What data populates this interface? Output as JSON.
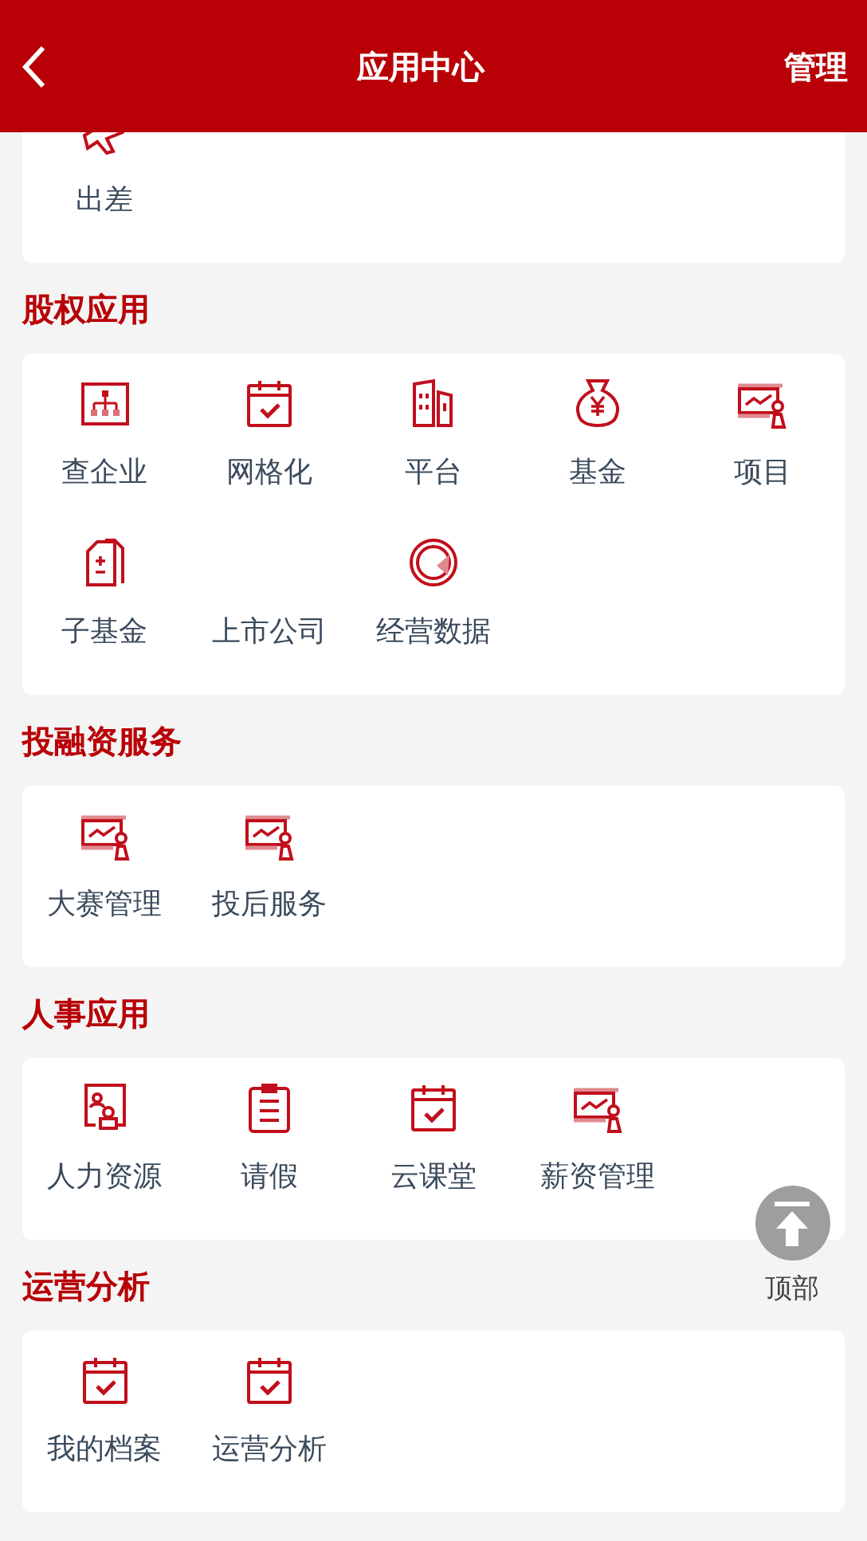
{
  "header": {
    "title": "应用中心",
    "action": "管理"
  },
  "sections": [
    {
      "items": [
        {
          "label": "出差"
        }
      ]
    },
    {
      "title": "股权应用",
      "items": [
        {
          "label": "查企业"
        },
        {
          "label": "网格化"
        },
        {
          "label": "平台"
        },
        {
          "label": "基金"
        },
        {
          "label": "项目"
        },
        {
          "label": "子基金"
        },
        {
          "label": "上市公司"
        },
        {
          "label": "经营数据"
        }
      ]
    },
    {
      "title": "投融资服务",
      "items": [
        {
          "label": "大赛管理"
        },
        {
          "label": "投后服务"
        }
      ]
    },
    {
      "title": "人事应用",
      "items": [
        {
          "label": "人力资源"
        },
        {
          "label": "请假"
        },
        {
          "label": "云课堂"
        },
        {
          "label": "薪资管理"
        }
      ]
    },
    {
      "title": "运营分析",
      "items": [
        {
          "label": "我的档案"
        },
        {
          "label": "运营分析"
        }
      ]
    }
  ],
  "back_to_top": {
    "label": "顶部"
  }
}
